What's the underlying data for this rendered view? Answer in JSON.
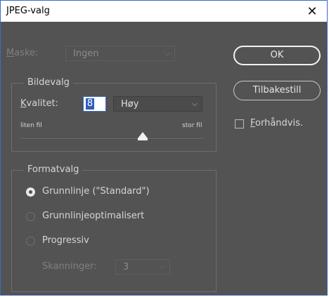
{
  "window": {
    "title": "JPEG-valg"
  },
  "mask": {
    "label_hotkey": "M",
    "label_rest": "aske:",
    "value": "Ingen"
  },
  "image_options": {
    "group_label": "Bildevalg",
    "quality_hotkey": "K",
    "quality_rest": "valitet:",
    "quality_value": "8",
    "quality_preset": "Høy",
    "slider_left_label": "liten fil",
    "slider_right_label": "stor fil",
    "slider_position": 0.67
  },
  "format_options": {
    "group_label": "Formatvalg",
    "options": [
      {
        "label": "Grunnlinje (\"Standard\")",
        "checked": true
      },
      {
        "label": "Grunnlinjeoptimalisert",
        "checked": false
      },
      {
        "label": "Progressiv",
        "checked": false
      }
    ],
    "scans_label": "Skanninger:",
    "scans_value": "3"
  },
  "buttons": {
    "ok": "OK",
    "reset": "Tilbakestill"
  },
  "preview": {
    "hotkey": "F",
    "rest": "orhåndvis.",
    "checked": false
  },
  "icons": {
    "close": "close-icon",
    "chevron": "chevron-down-icon"
  },
  "colors": {
    "dialog_bg": "#535353",
    "text": "#d6d6d6",
    "disabled_text": "#808080",
    "selection": "#2f5fb7",
    "window_border": "#3a6cc4"
  }
}
